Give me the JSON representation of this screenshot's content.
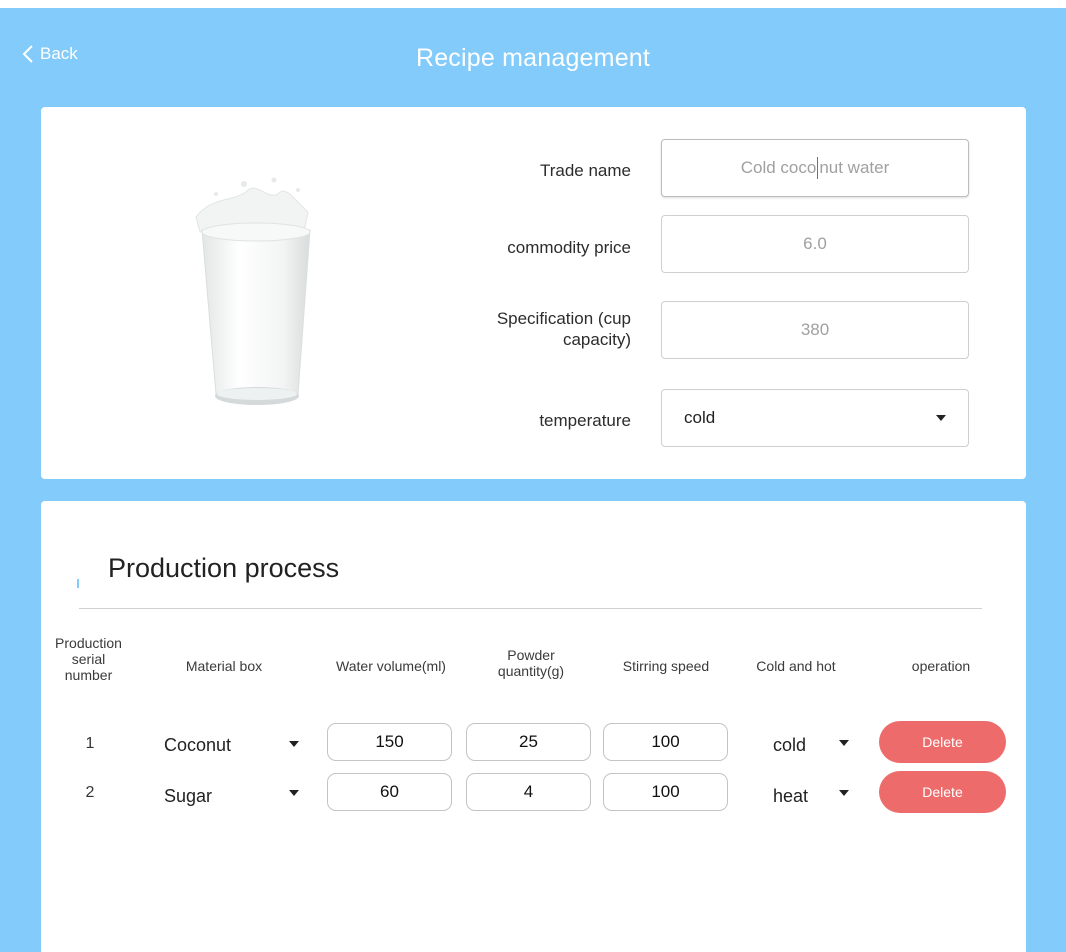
{
  "header": {
    "back_label": "Back",
    "title": "Recipe management"
  },
  "product": {
    "image_icon": "milk-glass-image",
    "fields": {
      "trade_name_label": "Trade name",
      "trade_name_value_before_caret": "Cold coco",
      "trade_name_value_after_caret": "nut water",
      "price_label": "commodity price",
      "price_value": "6.0",
      "spec_label_line1": "Specification (cup",
      "spec_label_line2": "capacity)",
      "spec_value": "380",
      "temperature_label": "temperature",
      "temperature_value": "cold"
    }
  },
  "process": {
    "title": "Production process",
    "headers": {
      "serial_line1": "Production",
      "serial_line2": "serial",
      "serial_line3": "number",
      "material_box": "Material box",
      "water_volume": "Water volume(ml)",
      "powder_line1": "Powder",
      "powder_line2": "quantity(g)",
      "stirring_speed": "Stirring speed",
      "cold_hot": "Cold and hot",
      "operation": "operation"
    },
    "rows": [
      {
        "serial": "1",
        "material": "Coconut",
        "water": "150",
        "powder": "25",
        "speed": "100",
        "temp": "cold",
        "action": "Delete"
      },
      {
        "serial": "2",
        "material": "Sugar",
        "water": "60",
        "powder": "4",
        "speed": "100",
        "temp": "heat",
        "action": "Delete"
      }
    ]
  },
  "colors": {
    "background": "#83cbfb",
    "delete_button": "#ee6b6b",
    "caret": "#1a9a88"
  }
}
